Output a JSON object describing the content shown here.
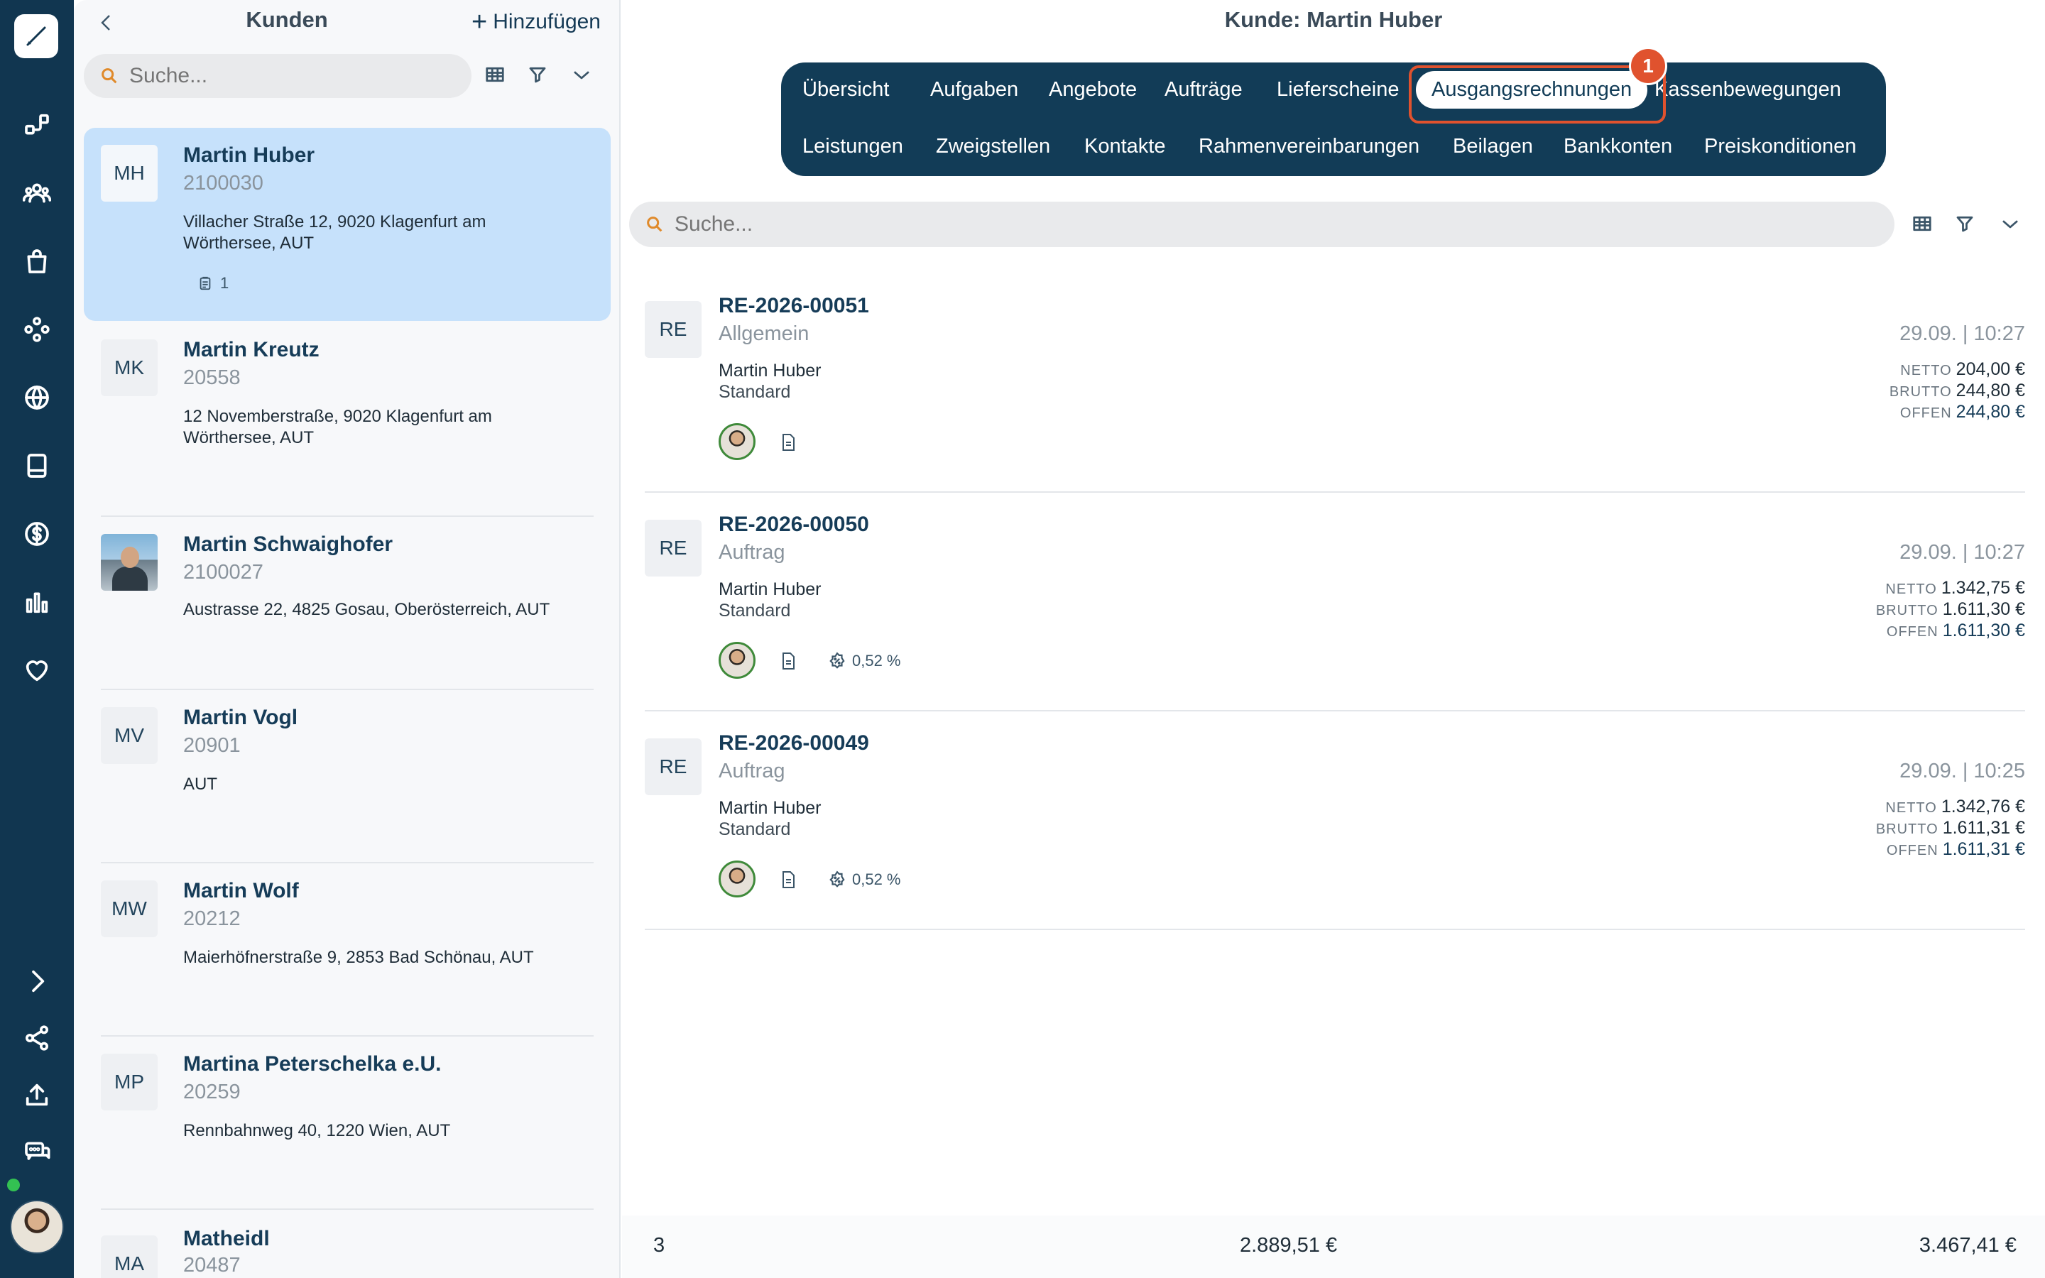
{
  "customers_panel": {
    "title": "Kunden",
    "add_label": "Hinzufügen",
    "search_placeholder": "Suche...",
    "customers": [
      {
        "initials": "MH",
        "name": "Martin Huber",
        "number": "2100030",
        "address": "Villacher Straße 12, 9020 Klagenfurt am Wörthersee, AUT",
        "badge_count": "1",
        "selected": true
      },
      {
        "initials": "MK",
        "name": "Martin Kreutz",
        "number": "20558",
        "address": "12 Novemberstraße, 9020 Klagenfurt am Wörthersee, AUT"
      },
      {
        "initials": "",
        "name": "Martin Schwaighofer",
        "number": "2100027",
        "address": "Austrasse 22, 4825 Gosau, Oberösterreich, AUT",
        "photo": true
      },
      {
        "initials": "MV",
        "name": "Martin Vogl",
        "number": "20901",
        "address": "AUT"
      },
      {
        "initials": "MW",
        "name": "Martin Wolf",
        "number": "20212",
        "address": "Maierhöfnerstraße 9, 2853 Bad Schönau, AUT"
      },
      {
        "initials": "MP",
        "name": "Martina Peterschelka e.U.",
        "number": "20259",
        "address": "Rennbahnweg 40, 1220 Wien, AUT"
      },
      {
        "initials": "MA",
        "name": "Matheidl",
        "number": "20487",
        "address": ""
      }
    ]
  },
  "main": {
    "title": "Kunde: Martin Huber",
    "tabs_row1": [
      "Übersicht",
      "Aufgaben",
      "Angebote",
      "Aufträge",
      "Lieferscheine",
      "Ausgangsrechnungen",
      "Kassenbewegungen"
    ],
    "tabs_row2": [
      "Leistungen",
      "Zweigstellen",
      "Kontakte",
      "Rahmenvereinbarungen",
      "Beilagen",
      "Bankkonten",
      "Preiskonditionen"
    ],
    "active_tab": "Ausgangsrechnungen",
    "highlight_badge": "1",
    "search_placeholder": "Suche...",
    "amount_labels": {
      "netto": "NETTO",
      "brutto": "BRUTTO",
      "offen": "OFFEN"
    },
    "invoices": [
      {
        "avatar": "RE",
        "number": "RE-2026-00051",
        "type": "Allgemein",
        "customer": "Martin Huber",
        "group": "Standard",
        "date": "29.09. | 10:27",
        "netto": "204,00 €",
        "brutto": "244,80 €",
        "offen": "244,80 €",
        "discount": ""
      },
      {
        "avatar": "RE",
        "number": "RE-2026-00050",
        "type": "Auftrag",
        "customer": "Martin Huber",
        "group": "Standard",
        "date": "29.09. | 10:27",
        "netto": "1.342,75 €",
        "brutto": "1.611,30 €",
        "offen": "1.611,30 €",
        "discount": "0,52 %"
      },
      {
        "avatar": "RE",
        "number": "RE-2026-00049",
        "type": "Auftrag",
        "customer": "Martin Huber",
        "group": "Standard",
        "date": "29.09. | 10:25",
        "netto": "1.342,76 €",
        "brutto": "1.611,31 €",
        "offen": "1.611,31 €",
        "discount": "0,52 %"
      }
    ],
    "footer": {
      "count": "3",
      "netto_total": "2.889,51 €",
      "brutto_total": "3.467,41 €"
    }
  },
  "colors": {
    "rail": "#113650",
    "accent": "#123c57",
    "highlight": "#e0522e",
    "selected": "#c6e1fb",
    "online": "#33c152"
  }
}
